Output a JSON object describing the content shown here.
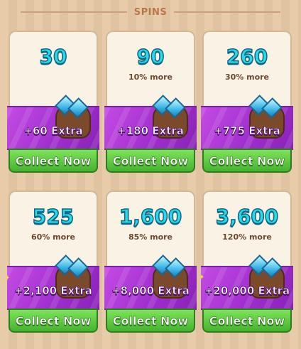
{
  "header": {
    "title": "SPINS"
  },
  "offers": [
    {
      "amount": "30",
      "more": "",
      "extra": "+60 Extra",
      "button": "Collect Now"
    },
    {
      "amount": "90",
      "more": "10% more",
      "extra": "+180 Extra",
      "button": "Collect Now"
    },
    {
      "amount": "260",
      "more": "30% more",
      "extra": "+775 Extra",
      "button": "Collect Now"
    },
    {
      "amount": "525",
      "more": "60% more",
      "extra": "+2,100 Extra",
      "button": "Collect Now"
    },
    {
      "amount": "1,600",
      "more": "85% more",
      "extra": "+8,000 Extra",
      "button": "Collect Now"
    },
    {
      "amount": "3,600",
      "more": "120% more",
      "extra": "+20,000 Extra",
      "button": "Collect Now"
    }
  ]
}
